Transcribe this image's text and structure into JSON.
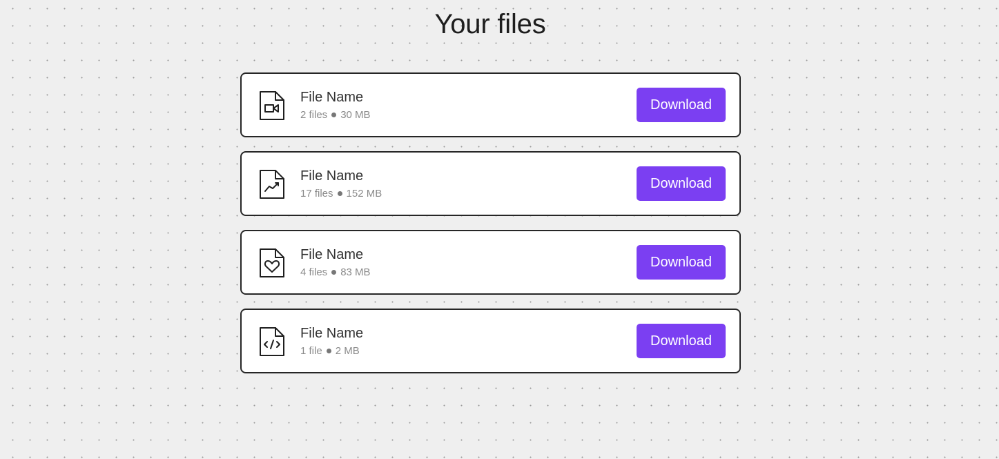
{
  "header": {
    "title": "Your files"
  },
  "files": [
    {
      "name": "File Name",
      "count": "2 files",
      "size": "30 MB",
      "icon": "file-video-icon",
      "action_label": "Download"
    },
    {
      "name": "File Name",
      "count": "17 files",
      "size": "152 MB",
      "icon": "file-chart-icon",
      "action_label": "Download"
    },
    {
      "name": "File Name",
      "count": "4 files",
      "size": "83 MB",
      "icon": "file-heart-icon",
      "action_label": "Download"
    },
    {
      "name": "File Name",
      "count": "1 file",
      "size": "2 MB",
      "icon": "file-code-icon",
      "action_label": "Download"
    }
  ],
  "colors": {
    "accent": "#7b3ff2",
    "background": "#efefef",
    "card_border": "#262626"
  }
}
